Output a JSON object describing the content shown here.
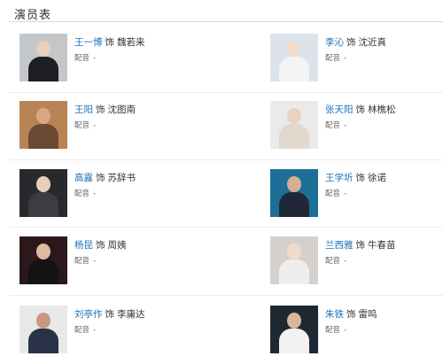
{
  "section_title": "演员表",
  "dub_label": "配音",
  "dub_value": "-",
  "as_word": "饰",
  "cast": [
    {
      "actor": "王一博",
      "role": "魏若来",
      "bg": "#c4c7c9",
      "skin": "#e9cfbd",
      "cloth": "#1d1e22"
    },
    {
      "actor": "李沁",
      "role": "沈近真",
      "bg": "#dce3ea",
      "skin": "#f2dccd",
      "cloth": "#f4f4f4"
    },
    {
      "actor": "王阳",
      "role": "沈图南",
      "bg": "#b88456",
      "skin": "#d8a787",
      "cloth": "#6b4a33"
    },
    {
      "actor": "张天阳",
      "role": "林樵松",
      "bg": "#eaeaea",
      "skin": "#ead2c0",
      "cloth": "#e2d8ce"
    },
    {
      "actor": "高露",
      "role": "苏辞书",
      "bg": "#27292c",
      "skin": "#e9cdbb",
      "cloth": "#3b3d42"
    },
    {
      "actor": "王学圻",
      "role": "徐诺",
      "bg": "#1e6f97",
      "skin": "#d6ae93",
      "cloth": "#202838"
    },
    {
      "actor": "杨昆",
      "role": "周姨",
      "bg": "#2a181a",
      "skin": "#e0b9a3",
      "cloth": "#141214"
    },
    {
      "actor": "兰西雅",
      "role": "牛春苗",
      "bg": "#d4d1cd",
      "skin": "#f1dbcb",
      "cloth": "#eeeeee"
    },
    {
      "actor": "刘亭作",
      "role": "李庸达",
      "bg": "#e8e8e8",
      "skin": "#c9987a",
      "cloth": "#293246"
    },
    {
      "actor": "朱铁",
      "role": "雷鸣",
      "bg": "#1d2a33",
      "skin": "#d9b59d",
      "cloth": "#f2f2f2"
    }
  ]
}
